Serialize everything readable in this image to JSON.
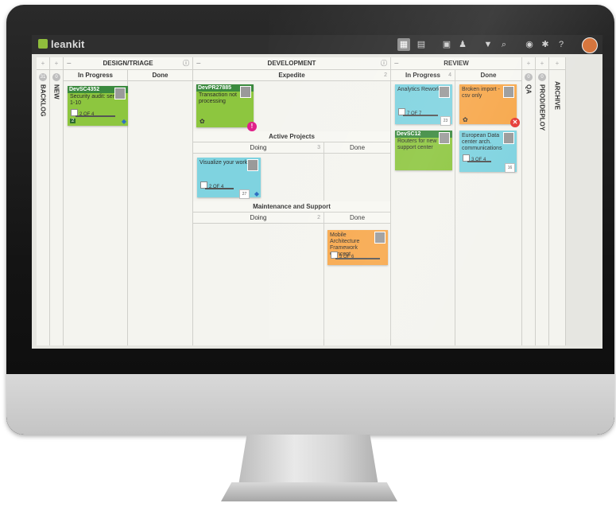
{
  "app": {
    "logo_text": "leankit"
  },
  "toolbar": {
    "icons": [
      "board-view-icon",
      "calendar-icon",
      "new-card-icon",
      "users-icon",
      "filter-icon",
      "search-icon",
      "share-icon",
      "settings-icon",
      "help-icon",
      "user-avatar"
    ]
  },
  "lanes": {
    "backlog": {
      "label": "BACKLOG",
      "count": "31"
    },
    "new": {
      "label": "NEW",
      "count": "0"
    },
    "design": {
      "label": "DESIGN/TRIAGE",
      "sub_in_progress": "In Progress",
      "sub_done": "Done"
    },
    "development": {
      "label": "DEVELOPMENT",
      "expedite": "Expedite",
      "expedite_count": "2",
      "active_projects": "Active Projects",
      "ap_doing": "Doing",
      "ap_doing_count": "3",
      "ap_done": "Done",
      "maintenance": "Maintenance and Support",
      "ms_doing": "Doing",
      "ms_doing_count": "2",
      "ms_done": "Done"
    },
    "review": {
      "label": "REVIEW",
      "sub_in_progress": "In Progress",
      "sub_in_progress_count": "4",
      "sub_done": "Done"
    },
    "qa": {
      "label": "QA",
      "count": "0"
    },
    "prod": {
      "label": "PROD/DEPLOY",
      "count": "0"
    },
    "archive": {
      "label": "ARCHIVE"
    }
  },
  "cards": {
    "c1": {
      "id": "DevSC4352",
      "title": "Security audit: servers 1-10",
      "tasks": "2 OF 4",
      "tag": "2"
    },
    "c2": {
      "id": "DevPR27885",
      "title": "Transaction not processing"
    },
    "c3": {
      "title": "Visualize your workflow",
      "tasks": "2 OF 4",
      "date": "27"
    },
    "c4": {
      "title": "Mobile Architecture Framework Concept",
      "tasks": "5 OF 6"
    },
    "c5": {
      "title": "Analytics Rework",
      "tasks": "7 OF 7",
      "date": "23"
    },
    "c6": {
      "id": "DevSC12",
      "title": "Routers for new support center"
    },
    "c7": {
      "title": "Broken import - csv only"
    },
    "c8": {
      "title": "European Data center arch. communications",
      "tasks": "3 OF 4",
      "date": "16"
    }
  },
  "colors": {
    "green": "#8dc63f",
    "blue": "#7fd3e0",
    "orange": "#f7a74a",
    "alert_pink": "#e0218a",
    "alert_red": "#e53935"
  }
}
